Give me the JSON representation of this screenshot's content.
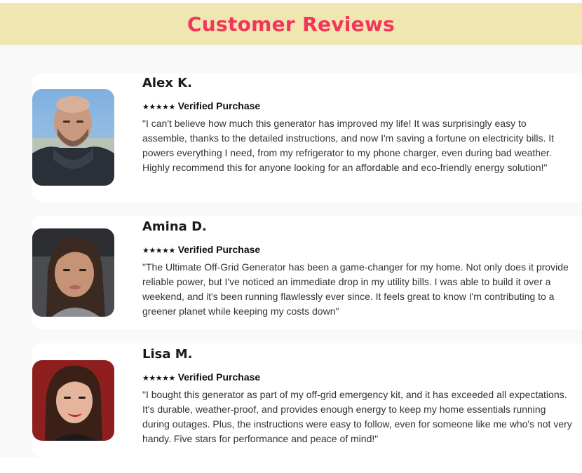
{
  "header": {
    "title": "Customer Reviews"
  },
  "reviews": [
    {
      "name": "Alex K.",
      "stars": "★★★★★",
      "verified_label": "Verified Purchase",
      "text": "\"I can't believe how much this generator has improved my life! It was surprisingly easy to assemble, thanks to the detailed instructions, and now I'm saving a fortune on electricity bills. It powers everything I need, from my refrigerator to my phone charger, even during bad weather. Highly recommend this for anyone looking for an affordable and eco-friendly energy solution!\""
    },
    {
      "name": "Amina D.",
      "stars": "★★★★★",
      "verified_label": "Verified Purchase",
      "text": "\"The Ultimate Off-Grid Generator has been a game-changer for my home. Not only does it provide reliable power, but I've noticed an immediate drop in my utility bills. I was able to build it over a weekend, and it's been running flawlessly ever since. It feels great to know I'm contributing to a greener planet while keeping my costs down\""
    },
    {
      "name": "Lisa M.",
      "stars": "★★★★★",
      "verified_label": "Verified Purchase",
      "text": "\"I bought this generator as part of my off-grid emergency kit, and it has exceeded all expectations. It's durable, weather-proof, and provides enough energy to keep my home essentials running during outages. Plus, the instructions were easy to follow, even for someone like me who's not very handy. Five stars for performance and peace of mind!\""
    }
  ]
}
